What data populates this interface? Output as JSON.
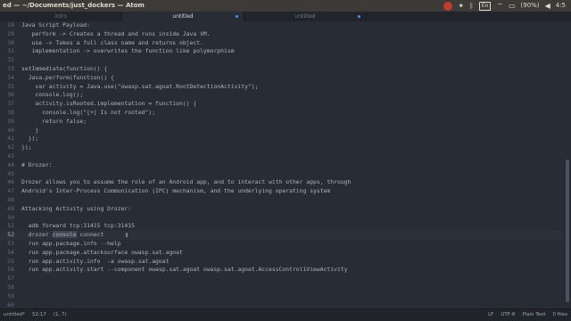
{
  "window": {
    "title": "ed — ~/Documents/just_dockers — Atom"
  },
  "tray": {
    "lang": "En",
    "battery": "(90%)",
    "time": "4:5"
  },
  "tabs": [
    {
      "label": "intro",
      "active": false,
      "modified": false
    },
    {
      "label": "untitled",
      "active": true,
      "modified": true
    },
    {
      "label": "untitled",
      "active": false,
      "modified": true
    }
  ],
  "editor": {
    "lines": [
      {
        "n": "28",
        "text": "Java Script Payload:"
      },
      {
        "n": "29",
        "text": "   perform -> Creates a thread and runs inside Java VM."
      },
      {
        "n": "30",
        "text": "   use -> Takes a full class name and returns object."
      },
      {
        "n": "31",
        "text": "   implementation -> overwrites the function like polymorphism"
      },
      {
        "n": "32",
        "text": ""
      },
      {
        "n": "33",
        "text": "setImmediate(function() {"
      },
      {
        "n": "34",
        "text": "  Java.perform(function() {"
      },
      {
        "n": "35",
        "text": "    var activity = Java.use(\"owasp.sat.agoat.RootDetectionActivity\");"
      },
      {
        "n": "36",
        "text": "    console.log();"
      },
      {
        "n": "37",
        "text": "    activity.isRooted.implementation = function() {"
      },
      {
        "n": "38",
        "text": "      console.log(\"[+] Is not rooted\");"
      },
      {
        "n": "39",
        "text": "      return false;"
      },
      {
        "n": "40",
        "text": "    }"
      },
      {
        "n": "41",
        "text": "  });"
      },
      {
        "n": "42",
        "text": "});"
      },
      {
        "n": "43",
        "text": ""
      },
      {
        "n": "44",
        "text": "# Drozer:"
      },
      {
        "n": "45",
        "text": ""
      },
      {
        "n": "46",
        "text": "Drozer allows you to assume the role of an Android app, and to interact with other apps, through"
      },
      {
        "n": "47",
        "text": "Android's Inter-Process Communication (IPC) mechanism, and the underlying operating system"
      },
      {
        "n": "48",
        "text": ""
      },
      {
        "n": "49",
        "text": "Attacking Activity using Drozer:"
      },
      {
        "n": "50",
        "text": ""
      },
      {
        "n": "51",
        "text": "  adb forward tcp:31415 tcp:31415"
      },
      {
        "n": "52",
        "text_pre": "  drozer ",
        "text_hl": "console",
        "text_post": " connect",
        "current": true
      },
      {
        "n": "53",
        "text": "  run app.package.info --help"
      },
      {
        "n": "54",
        "text": "  run app.package.attacksurface owasp.sat.agoat"
      },
      {
        "n": "55",
        "text": "  run app.activity.info  -a owasp.sat.agoat"
      },
      {
        "n": "56",
        "text": "  run app.activity.start --component owasp.sat.agoat owasp.sat.agoat.AccessControl1ViewActivity"
      },
      {
        "n": "57",
        "text": ""
      },
      {
        "n": "58",
        "text": ""
      },
      {
        "n": "59",
        "text": ""
      },
      {
        "n": "60",
        "text": ""
      }
    ]
  },
  "status": {
    "file": "untitled*",
    "line_col": "52:17",
    "selection": "(1, 7)",
    "line_ending": "LF",
    "encoding": "UTF-8",
    "grammar": "Plain Text",
    "files": "0 files"
  }
}
